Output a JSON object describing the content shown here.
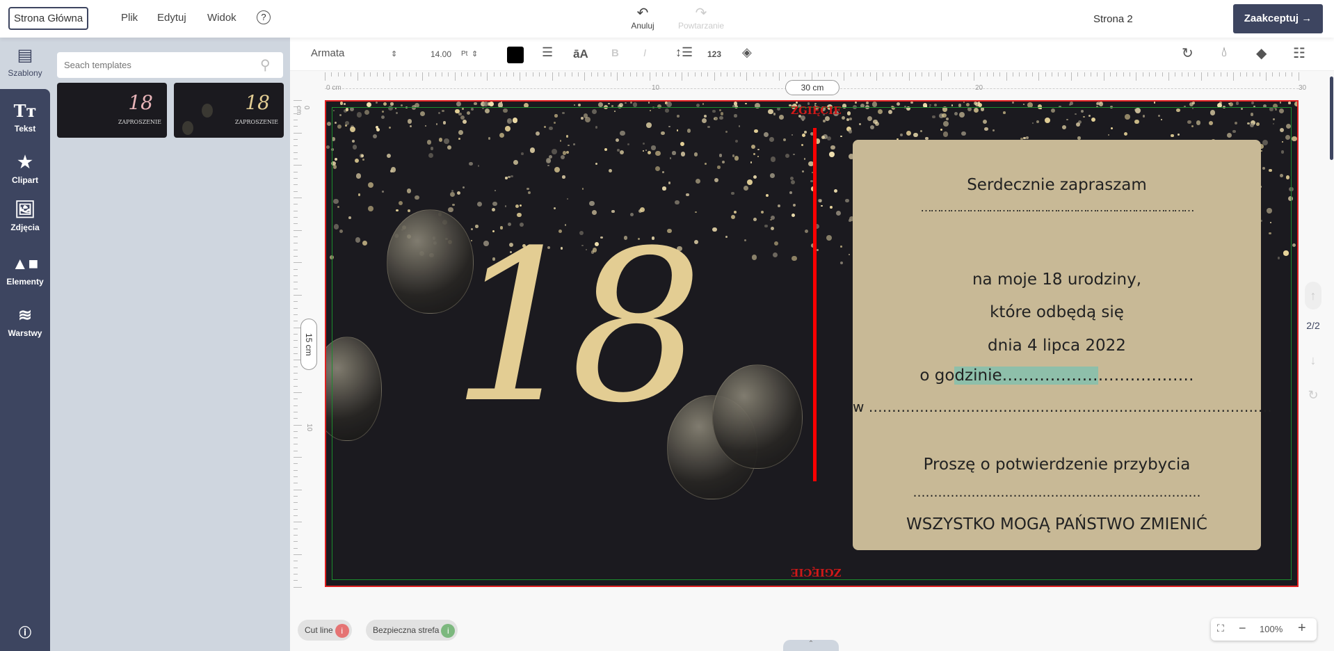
{
  "header": {
    "home": "Strona Główna",
    "menu": [
      "Plik",
      "Edytuj",
      "Widok"
    ],
    "help": "?",
    "undo": "Anuluj",
    "redo": "Powtarzanie",
    "page": "Strona 2",
    "accept": "Zaakceptuj →"
  },
  "rail": [
    {
      "label": "Szablony",
      "icon": "id-card-icon"
    },
    {
      "label": "Tekst",
      "icon": "text-icon"
    },
    {
      "label": "Clipart",
      "icon": "star-icon"
    },
    {
      "label": "Zdjęcia",
      "icon": "image-icon"
    },
    {
      "label": "Elementy",
      "icon": "shapes-icon"
    },
    {
      "label": "Warstwy",
      "icon": "layers-icon"
    }
  ],
  "panel": {
    "search_placeholder": "Seach templates",
    "templates": [
      {
        "number": "18",
        "title": "ZAPROSZENIE",
        "color": "#e8b4b8"
      },
      {
        "number": "18",
        "title": "ZAPROSZENIE",
        "color": "#e3cd93"
      }
    ]
  },
  "toolbar": {
    "font": "Armata",
    "size": "14.00",
    "unit": "Pt",
    "color": "#000000"
  },
  "ruler": {
    "h": [
      "0 cm",
      "10",
      "20",
      "30"
    ],
    "v": [
      "0 cm",
      "10"
    ],
    "width": "30 cm",
    "height": "15 cm"
  },
  "canvas": {
    "big_number": "18",
    "fold_label": "ZGIĘCIE",
    "lines": [
      "Serdecznie zapraszam",
      "…………………………………………………………………………",
      "na moje 18 urodziny,",
      "które odbędą się",
      "dnia 4 lipca 2022"
    ],
    "hour_pre": "o go",
    "hour_sel": "dzinie………………",
    "hour_post": "………………",
    "place": "w ……………………………………………………………………………",
    "confirm": "Proszę o potwierdzenie przybycia",
    "confirm_line": "……………………………………………………………",
    "footer": "WSZYSTKO MOGĄ PAŃSTWO ZMIENIĆ"
  },
  "pager": {
    "label": "2/2"
  },
  "bottom": {
    "cut_line": "Cut line",
    "safe_zone": "Bezpieczna strefa",
    "zoom": "100%"
  }
}
